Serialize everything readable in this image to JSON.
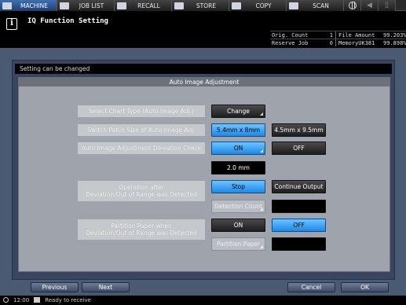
{
  "tabs": [
    {
      "label": "MACHINE",
      "icon": "machine-icon",
      "active": true
    },
    {
      "label": "JOB LIST",
      "icon": "job-list-icon",
      "active": false
    },
    {
      "label": "RECALL",
      "icon": "recall-icon",
      "active": false
    },
    {
      "label": "STORE",
      "icon": "store-icon",
      "active": false
    },
    {
      "label": "COPY",
      "icon": "copy-icon",
      "active": false
    },
    {
      "label": "SCAN",
      "icon": "scan-icon",
      "active": false
    }
  ],
  "header": {
    "title": "IQ Function Setting",
    "counters": [
      {
        "label": "Orig. Count",
        "value": "1",
        "label2": "File Amount",
        "value2": "99.203%"
      },
      {
        "label": "Reserve Job",
        "value": "0",
        "label2": "MemoryUK381",
        "value2": "99.898%"
      }
    ]
  },
  "message": "Setting can be changed",
  "panel_title": "Auto Image Adjustment",
  "rows": {
    "chart_type": {
      "label": "Select Chart Type (Auto Image Adj.)",
      "button": "Change"
    },
    "patch_size": {
      "label": "Switch Patch Size of Auto Image Adj.",
      "option1": "5.4mm x 8mm",
      "option2": "4.5mm x 9.5mm"
    },
    "deviation_check": {
      "label": "Auto Image Adjustment Deviation Check",
      "on": "ON",
      "off": "OFF",
      "value": "2.0 mm"
    },
    "operation": {
      "label_line1": "Operation after",
      "label_line2": "Deviation/Out of Range was Detected",
      "stop": "Stop",
      "continue": "Continue Output",
      "detection_count": "Detection Count"
    },
    "partition": {
      "label_line1": "Partition Paper when",
      "label_line2": "Deviation/Out of Range was Detected",
      "on": "ON",
      "off": "OFF",
      "partition_paper": "Partition Paper"
    }
  },
  "nav": {
    "previous": "Previous",
    "next": "Next",
    "cancel": "Cancel",
    "ok": "OK"
  },
  "status": {
    "time": "12:00",
    "text": "Ready to receive"
  },
  "colors": {
    "selected": "#1e88e8",
    "frame": "#4b5a73",
    "content": "#9fa4ac"
  }
}
